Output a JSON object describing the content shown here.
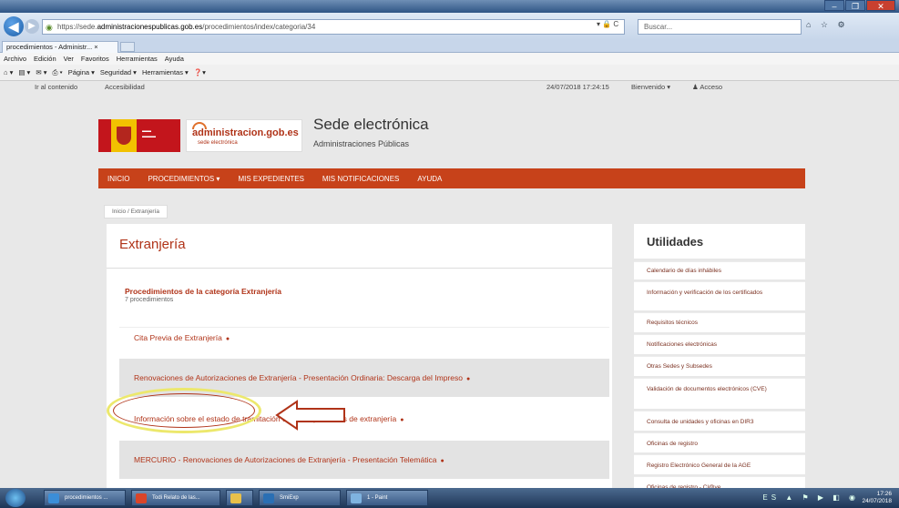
{
  "browser": {
    "url_prefix": "https://sede.",
    "url_domain": "administracionespublicas.gob.es",
    "url_path": "/procedimientos/index/categoria/34",
    "url_buttons": "▾ 🔒 C",
    "search_placeholder": "Buscar...",
    "tab_label": "procedimientos - Administr... ×",
    "menu": [
      "Archivo",
      "Edición",
      "Ver",
      "Favoritos",
      "Herramientas",
      "Ayuda"
    ],
    "command_bar": [
      "Página ▾",
      "Seguridad ▾",
      "Herramientas ▾"
    ],
    "window_controls": [
      "–",
      "❐",
      "✕"
    ],
    "toolbar_icons": "⌂ ☆ ⚙"
  },
  "site": {
    "skip_link": "Ir al contenido",
    "accessibility": "Accesibilidad",
    "datetime": "24/07/2018 17:24:15",
    "welcome": "Bienvenido ▾",
    "access": "Acceso",
    "logo_main": "administracion.gob.es",
    "logo_sub": "sede electrónica",
    "title": "Sede electrónica",
    "subtitle": "Administraciones Públicas",
    "nav": [
      "Inicio",
      "Procedimientos ▾",
      "Mis expedientes",
      "Mis notificaciones",
      "Ayuda"
    ],
    "breadcrumb": "Inicio / Extranjería"
  },
  "main": {
    "heading": "Extranjería",
    "category_title": "Procedimientos de la categoría Extranjería",
    "category_count": "7 procedimientos",
    "procedures": [
      "Cita Previa de Extranjería",
      "Renovaciones de Autorizaciones de Extranjería - Presentación Ordinaria: Descarga del Impreso",
      "Información sobre el estado de tramitación de los expedientes de extranjería",
      "MERCURIO - Renovaciones de Autorizaciones de Extranjería - Presentación Telemática"
    ],
    "bullet": "●"
  },
  "sidebar": {
    "title": "Utilidades",
    "items": [
      "Calendario de días inhábiles",
      "Información y verificación de los certificados",
      "Requisitos técnicos",
      "Notificaciones electrónicas",
      "Otras Sedes y Subsedes",
      "Validación de documentos electrónicos (CVE)",
      "Consulta de unidades y oficinas en DIR3",
      "Oficinas de registro",
      "Registro Electrónico General de la AGE",
      "Oficinas de registro - Cl@ve"
    ]
  },
  "taskbar": {
    "buttons": [
      "procedimientos ...",
      "Todi Relato de las...",
      "",
      "SmiExp",
      "1 - Paint"
    ],
    "time": "17:26",
    "date": "24/07/2018",
    "tray_icons": "ES ▲ ⚑ ▶ ◧ ◉"
  },
  "colors": {
    "brand": "#c7421a",
    "link": "#b03318",
    "highlight_ellipse": "#ece86c",
    "callout_arrow": "#b03318"
  }
}
